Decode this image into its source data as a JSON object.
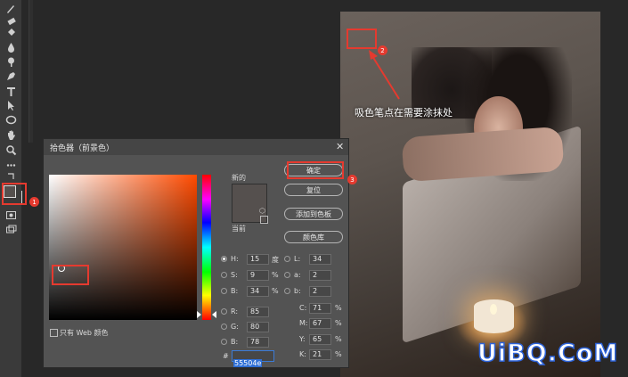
{
  "photo": {
    "caption": "吸色笔点在需要涂抹处"
  },
  "dialog": {
    "title": "拾色器（前景色）",
    "close": "✕",
    "new_label": "新的",
    "current_label": "当前",
    "new_color": "#55504e",
    "buttons": {
      "ok": "确定",
      "reset": "复位",
      "add_swatch": "添加到色板",
      "library": "颜色库"
    },
    "web_only_label": "只有 Web 颜色",
    "hsb": [
      {
        "label": "H:",
        "value": "15",
        "unit": "度"
      },
      {
        "label": "S:",
        "value": "9",
        "unit": "%"
      },
      {
        "label": "B:",
        "value": "34",
        "unit": "%"
      }
    ],
    "rgb": [
      {
        "label": "R:",
        "value": "85"
      },
      {
        "label": "G:",
        "value": "80"
      },
      {
        "label": "B:",
        "value": "78"
      }
    ],
    "lab": [
      {
        "label": "L:",
        "value": "34"
      },
      {
        "label": "a:",
        "value": "2"
      },
      {
        "label": "b:",
        "value": "2"
      }
    ],
    "cmyk": [
      {
        "label": "C:",
        "value": "71",
        "unit": "%"
      },
      {
        "label": "M:",
        "value": "67",
        "unit": "%"
      },
      {
        "label": "Y:",
        "value": "65",
        "unit": "%"
      },
      {
        "label": "K:",
        "value": "21",
        "unit": "%"
      }
    ],
    "hex_label": "#",
    "hex_value": "55504e"
  },
  "badges": [
    "1",
    "2",
    "3"
  ],
  "watermark": "UiBQ.CoM",
  "colors": {
    "accent_red": "#e53a2f",
    "hex_highlight": "#2f6fd6"
  }
}
